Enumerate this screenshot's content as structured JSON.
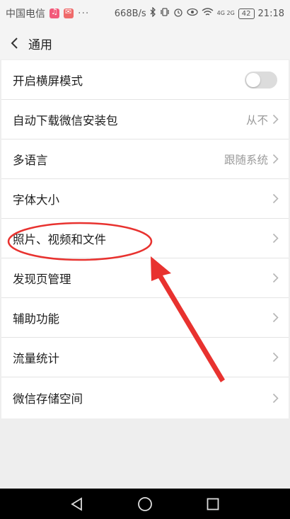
{
  "status_bar": {
    "carrier": "中国电信",
    "dots": "···",
    "speed": "668B/s",
    "network": "4G 2G",
    "battery": "42",
    "time": "21:18"
  },
  "header": {
    "title": "通用"
  },
  "settings": [
    {
      "label": "开启横屏模式",
      "type": "toggle",
      "toggle_on": false
    },
    {
      "label": "自动下载微信安装包",
      "value": "从不"
    },
    {
      "label": "多语言",
      "value": "跟随系统"
    },
    {
      "label": "字体大小"
    },
    {
      "label": "照片、视频和文件"
    },
    {
      "label": "发现页管理"
    },
    {
      "label": "辅助功能"
    },
    {
      "label": "流量统计"
    },
    {
      "label": "微信存储空间"
    }
  ],
  "colors": {
    "annotation": "#e8322f",
    "toggle_off": "#dcdcdc",
    "value_text": "#9a9a9a"
  }
}
